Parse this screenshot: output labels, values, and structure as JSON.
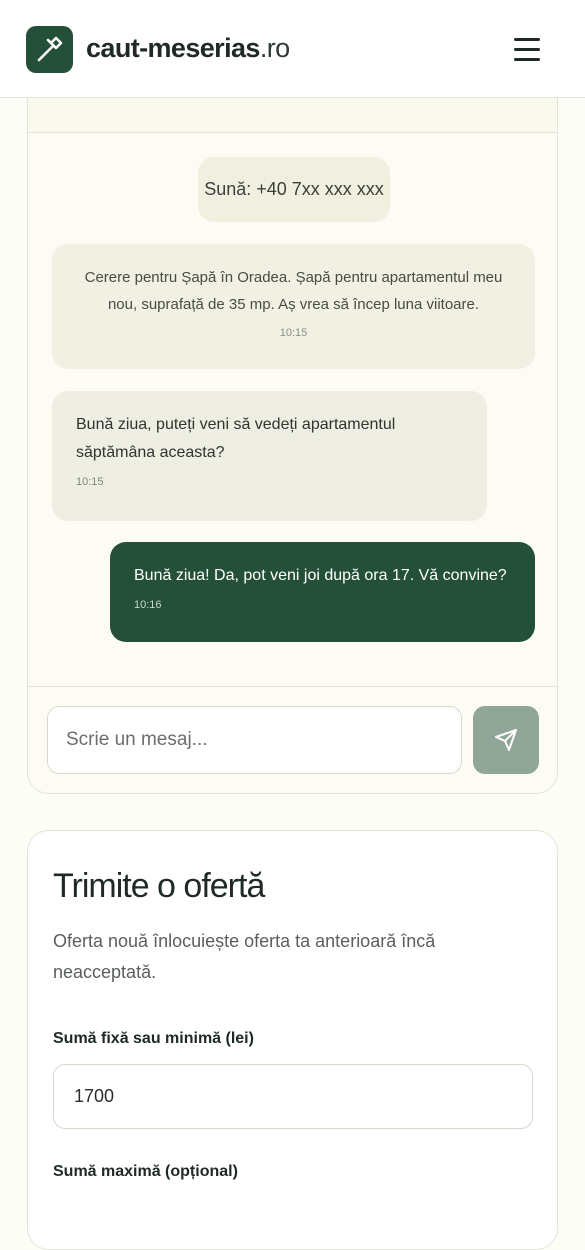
{
  "header": {
    "brand_name": "caut-meserias",
    "brand_tld": ".ro",
    "logo_icon": "hammer-icon",
    "menu_icon": "hamburger-menu-icon"
  },
  "chat": {
    "call_button_label": "Sună: +40 7xx xxx xxx",
    "messages": [
      {
        "type": "system",
        "text": "Cerere pentru Șapă în Oradea. Șapă pentru apartamentul meu nou, suprafață de 35 mp. Aș vrea să încep luna viitoare.",
        "time": "10:15"
      },
      {
        "type": "incoming",
        "text": "Bună ziua, puteți veni să vedeți apartamentul săptămâna aceasta?",
        "time": "10:15"
      },
      {
        "type": "outgoing",
        "text": "Bună ziua! Da, pot veni joi după ora 17. Vă convine?",
        "time": "10:16"
      }
    ],
    "composer": {
      "placeholder": "Scrie un mesaj...",
      "send_icon": "send-icon"
    }
  },
  "offer": {
    "title": "Trimite o ofertă",
    "description": "Oferta nouă înlocuiește oferta ta anterioară încă neacceptată.",
    "min_amount_label": "Sumă fixă sau minimă (lei)",
    "min_amount_value": "1700",
    "max_amount_label": "Sumă maximă (opțional)"
  },
  "colors": {
    "brand_green": "#245039",
    "send_button": "#8fa699",
    "card_background": "#fcfcf4"
  }
}
